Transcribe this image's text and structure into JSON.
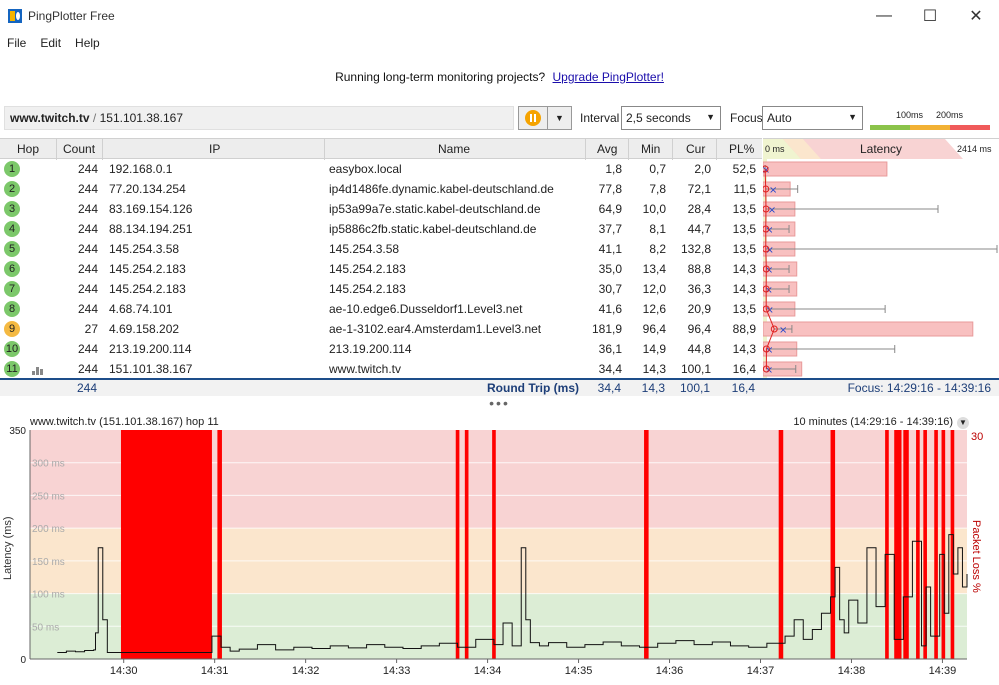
{
  "window": {
    "title": "PingPlotter Free",
    "minimize": "—",
    "maximize": "☐",
    "close": "✕"
  },
  "menu": [
    "File",
    "Edit",
    "Help"
  ],
  "banner": {
    "text": "Running long-term monitoring projects?",
    "link": "Upgrade PingPlotter!"
  },
  "toolbar": {
    "target_host": "www.twitch.tv",
    "target_sep": "/",
    "target_ip": "151.101.38.167",
    "interval_label": "Interval",
    "interval_value": "2,5 seconds",
    "focus_label": "Focus",
    "focus_value": "Auto",
    "scale_100": "100ms",
    "scale_200": "200ms",
    "colors": {
      "green": "#8bc34a",
      "yellow": "#f2b134",
      "red": "#f05a5a"
    }
  },
  "table": {
    "headers": {
      "hop": "Hop",
      "count": "Count",
      "ip": "IP",
      "name": "Name",
      "avg": "Avg",
      "min": "Min",
      "cur": "Cur",
      "pl": "PL%",
      "lat_min": "0 ms",
      "latency": "Latency",
      "lat_max": "2414 ms"
    },
    "rows": [
      {
        "hop": "1",
        "count": "244",
        "ip": "192.168.0.1",
        "name": "easybox.local",
        "avg": "1,8",
        "min": "0,7",
        "cur": "2,0",
        "pl": "52,5",
        "status": "#7cc86a"
      },
      {
        "hop": "2",
        "count": "244",
        "ip": "77.20.134.254",
        "name": "ip4d1486fe.dynamic.kabel-deutschland.de",
        "avg": "77,8",
        "min": "7,8",
        "cur": "72,1",
        "pl": "11,5",
        "status": "#7cc86a"
      },
      {
        "hop": "3",
        "count": "244",
        "ip": "83.169.154.126",
        "name": "ip53a99a7e.static.kabel-deutschland.de",
        "avg": "64,9",
        "min": "10,0",
        "cur": "28,4",
        "pl": "13,5",
        "status": "#7cc86a"
      },
      {
        "hop": "4",
        "count": "244",
        "ip": "88.134.194.251",
        "name": "ip5886c2fb.static.kabel-deutschland.de",
        "avg": "37,7",
        "min": "8,1",
        "cur": "44,7",
        "pl": "13,5",
        "status": "#7cc86a"
      },
      {
        "hop": "5",
        "count": "244",
        "ip": "145.254.3.58",
        "name": "145.254.3.58",
        "avg": "41,1",
        "min": "8,2",
        "cur": "132,8",
        "pl": "13,5",
        "status": "#7cc86a"
      },
      {
        "hop": "6",
        "count": "244",
        "ip": "145.254.2.183",
        "name": "145.254.2.183",
        "avg": "35,0",
        "min": "13,4",
        "cur": "88,8",
        "pl": "14,3",
        "status": "#7cc86a"
      },
      {
        "hop": "7",
        "count": "244",
        "ip": "145.254.2.183",
        "name": "145.254.2.183",
        "avg": "30,7",
        "min": "12,0",
        "cur": "36,3",
        "pl": "14,3",
        "status": "#7cc86a"
      },
      {
        "hop": "8",
        "count": "244",
        "ip": "4.68.74.101",
        "name": "ae-10.edge6.Dusseldorf1.Level3.net",
        "avg": "41,6",
        "min": "12,6",
        "cur": "20,9",
        "pl": "13,5",
        "status": "#7cc86a"
      },
      {
        "hop": "9",
        "count": "27",
        "ip": "4.69.158.202",
        "name": "ae-1-3102.ear4.Amsterdam1.Level3.net",
        "avg": "181,9",
        "min": "96,4",
        "cur": "96,4",
        "pl": "88,9",
        "status": "#f4b942"
      },
      {
        "hop": "10",
        "count": "244",
        "ip": "213.19.200.114",
        "name": "213.19.200.114",
        "avg": "36,1",
        "min": "14,9",
        "cur": "44,8",
        "pl": "14,3",
        "status": "#7cc86a"
      },
      {
        "hop": "11",
        "count": "244",
        "ip": "151.101.38.167",
        "name": "www.twitch.tv",
        "avg": "34,4",
        "min": "14,3",
        "cur": "100,1",
        "pl": "16,4",
        "status": "#7cc86a"
      }
    ],
    "footer": {
      "count": "244",
      "label": "Round Trip (ms)",
      "avg": "34,4",
      "min": "14,3",
      "cur": "100,1",
      "pl": "16,4",
      "focus": "Focus: 14:29:16 - 14:39:16"
    },
    "latency_bars": [
      {
        "avg": 1.8,
        "min": 0.7,
        "max": 2.0,
        "pl": 52.5
      },
      {
        "avg": 77.8,
        "min": 7.8,
        "max": 340,
        "pl": 11.5
      },
      {
        "avg": 64.9,
        "min": 10.0,
        "max": 1800,
        "pl": 13.5
      },
      {
        "avg": 37.7,
        "min": 8.1,
        "max": 250,
        "pl": 13.5
      },
      {
        "avg": 41.1,
        "min": 8.2,
        "max": 2414,
        "pl": 13.5
      },
      {
        "avg": 35.0,
        "min": 13.4,
        "max": 250,
        "pl": 14.3
      },
      {
        "avg": 30.7,
        "min": 12.0,
        "max": 250,
        "pl": 14.3
      },
      {
        "avg": 41.6,
        "min": 12.6,
        "max": 1250,
        "pl": 13.5
      },
      {
        "avg": 181.9,
        "min": 96.4,
        "max": 280,
        "pl": 88.9
      },
      {
        "avg": 36.1,
        "min": 14.9,
        "max": 1350,
        "pl": 14.3
      },
      {
        "avg": 34.4,
        "min": 14.3,
        "max": 320,
        "pl": 16.4
      }
    ]
  },
  "splitter": "•••",
  "chart_data": {
    "type": "line",
    "title": "www.twitch.tv (151.101.38.167) hop 11",
    "range_label": "10 minutes (14:29:16 - 14:39:16)",
    "ylabel": "Latency (ms)",
    "y2label": "Packet Loss %",
    "ylim": [
      0,
      350
    ],
    "y2_top": "30",
    "y_ticks": [
      "350",
      "300 ms",
      "250 ms",
      "200 ms",
      "150 ms",
      "100 ms",
      "50 ms",
      "0"
    ],
    "x_ticks": [
      "14:30",
      "14:31",
      "14:32",
      "14:33",
      "14:34",
      "14:35",
      "14:36",
      "14:37",
      "14:38",
      "14:39"
    ],
    "zones": [
      {
        "from": 0,
        "to": 100,
        "color": "#dcedd5"
      },
      {
        "from": 100,
        "to": 200,
        "color": "#fbe6cd"
      },
      {
        "from": 200,
        "to": 350,
        "color": "#f8d3d3"
      }
    ],
    "loss_spans_minutes": [
      [
        0.7,
        1.7
      ],
      [
        1.76,
        1.81
      ],
      [
        4.38,
        4.42
      ],
      [
        4.48,
        4.52
      ],
      [
        4.78,
        4.82
      ],
      [
        6.45,
        6.5
      ],
      [
        7.93,
        7.98
      ],
      [
        8.5,
        8.55
      ],
      [
        9.1,
        9.14
      ],
      [
        9.2,
        9.28
      ],
      [
        9.3,
        9.36
      ],
      [
        9.44,
        9.48
      ],
      [
        9.52,
        9.56
      ],
      [
        9.64,
        9.68
      ],
      [
        9.72,
        9.76
      ],
      [
        9.82,
        9.86
      ]
    ],
    "series_minutes": [
      0,
      0.1,
      0.2,
      0.3,
      0.4,
      0.42,
      0.45,
      0.5,
      0.55,
      1.7,
      1.8,
      1.9,
      2.0,
      2.2,
      2.4,
      2.6,
      2.8,
      3.0,
      3.2,
      3.4,
      3.6,
      3.8,
      4.0,
      4.2,
      4.4,
      4.6,
      4.8,
      4.9,
      5.0,
      5.1,
      5.15,
      5.2,
      5.3,
      5.4,
      5.6,
      5.8,
      6.0,
      6.2,
      6.4,
      6.6,
      6.8,
      7.0,
      7.2,
      7.4,
      7.6,
      7.8,
      8.0,
      8.1,
      8.2,
      8.3,
      8.4,
      8.5,
      8.55,
      8.6,
      8.65,
      8.7,
      8.8,
      8.9,
      9.0,
      9.1,
      9.2,
      9.3,
      9.4,
      9.5,
      9.55,
      9.6,
      9.7,
      9.75,
      9.8,
      9.85,
      9.9,
      9.95,
      10.0
    ],
    "series_ms": [
      10,
      12,
      11,
      13,
      14,
      40,
      170,
      60,
      10,
      35,
      18,
      12,
      15,
      22,
      14,
      18,
      16,
      20,
      17,
      22,
      18,
      16,
      20,
      24,
      18,
      30,
      22,
      55,
      20,
      170,
      60,
      25,
      20,
      25,
      18,
      22,
      26,
      20,
      18,
      24,
      28,
      22,
      26,
      20,
      18,
      24,
      35,
      60,
      30,
      45,
      70,
      95,
      140,
      60,
      40,
      90,
      55,
      170,
      80,
      160,
      30,
      95,
      180,
      20,
      110,
      35,
      160,
      70,
      190,
      130,
      170,
      110,
      130
    ]
  }
}
